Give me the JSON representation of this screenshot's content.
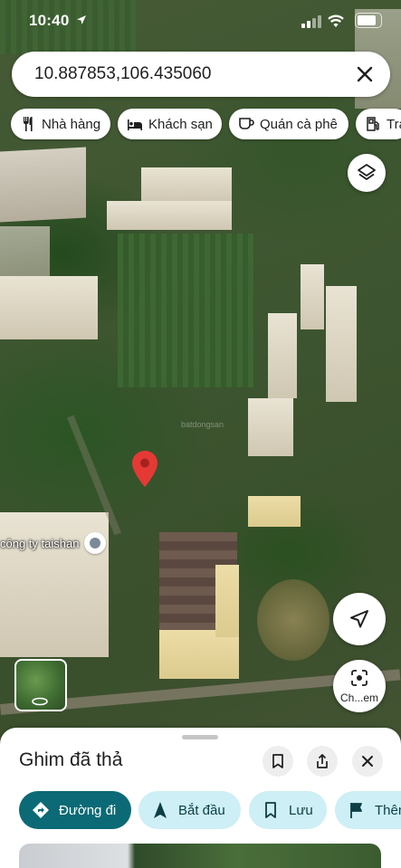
{
  "status_bar": {
    "time": "10:40",
    "battery_level": 0.85
  },
  "search": {
    "value": "10.887853,106.435060"
  },
  "chips": [
    {
      "label": "Nhà hàng",
      "icon": "fork-knife-icon"
    },
    {
      "label": "Khách sạn",
      "icon": "bed-icon"
    },
    {
      "label": "Quán cà phê",
      "icon": "coffee-cup-icon"
    },
    {
      "label": "Trạm xăng",
      "icon": "gas-pump-icon"
    }
  ],
  "map": {
    "poi_label": "công ty taishan",
    "watermark": "batdongsan",
    "pin_color": "#e53935"
  },
  "lens_button": {
    "label": "Ch...em"
  },
  "sheet": {
    "title": "Ghim đã thả",
    "actions": {
      "directions": "Đường đi",
      "start": "Bắt đầu",
      "save": "Lưu",
      "add": "Thêm"
    }
  },
  "colors": {
    "primary": "#0b6a75",
    "secondary": "#cdeff5"
  }
}
